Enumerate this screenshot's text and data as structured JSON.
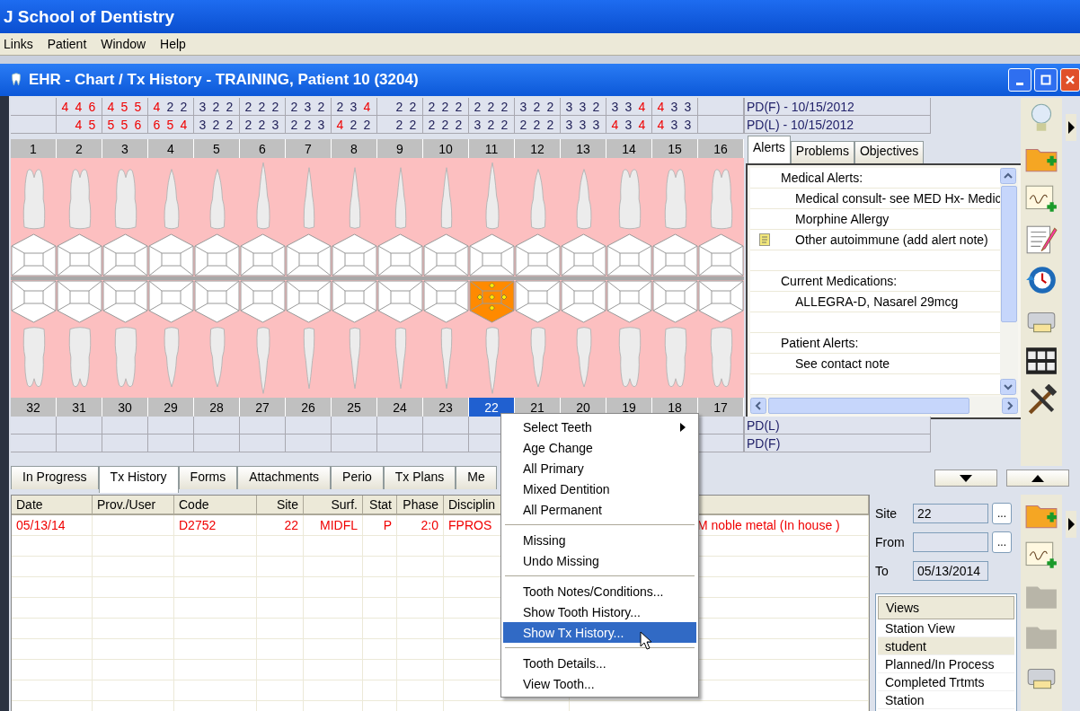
{
  "app_title": "J School of Dentistry",
  "menu": [
    "Links",
    "Patient",
    "Window",
    "Help"
  ],
  "window": {
    "title": "EHR - Chart / Tx History - TRAINING, Patient 10 (3204)"
  },
  "pd_upper": [
    {
      "label": "PD(F) - 10/15/2012",
      "cells": [
        [],
        [
          {
            "d": "4",
            "high": true
          },
          {
            "d": "4",
            "high": true
          },
          {
            "d": "6",
            "high": true
          }
        ],
        [
          {
            "d": "4",
            "high": true
          },
          {
            "d": "5",
            "high": true
          },
          {
            "d": "5",
            "high": true
          }
        ],
        [
          {
            "d": "4",
            "high": true
          },
          {
            "d": "2",
            "high": false
          },
          {
            "d": "2",
            "high": false
          }
        ],
        [
          {
            "d": "3",
            "high": false
          },
          {
            "d": "2",
            "high": false
          },
          {
            "d": "2",
            "high": false
          }
        ],
        [
          {
            "d": "2",
            "high": false
          },
          {
            "d": "2",
            "high": false
          },
          {
            "d": "2",
            "high": false
          }
        ],
        [
          {
            "d": "2",
            "high": false
          },
          {
            "d": "3",
            "high": false
          },
          {
            "d": "2",
            "high": false
          }
        ],
        [
          {
            "d": "2",
            "high": false
          },
          {
            "d": "3",
            "high": false
          },
          {
            "d": "4",
            "high": true
          }
        ],
        [
          {
            "d": "2",
            "high": false
          },
          {
            "d": "2",
            "high": false
          }
        ],
        [
          {
            "d": "2",
            "high": false
          },
          {
            "d": "2",
            "high": false
          },
          {
            "d": "2",
            "high": false
          }
        ],
        [
          {
            "d": "2",
            "high": false
          },
          {
            "d": "2",
            "high": false
          },
          {
            "d": "2",
            "high": false
          }
        ],
        [
          {
            "d": "3",
            "high": false
          },
          {
            "d": "2",
            "high": false
          },
          {
            "d": "2",
            "high": false
          }
        ],
        [
          {
            "d": "3",
            "high": false
          },
          {
            "d": "3",
            "high": false
          },
          {
            "d": "2",
            "high": false
          }
        ],
        [
          {
            "d": "3",
            "high": false
          },
          {
            "d": "3",
            "high": false
          },
          {
            "d": "4",
            "high": true
          }
        ],
        [
          {
            "d": "4",
            "high": true
          },
          {
            "d": "3",
            "high": false
          },
          {
            "d": "3",
            "high": false
          }
        ],
        []
      ]
    },
    {
      "label": "PD(L) - 10/15/2012",
      "cells": [
        [],
        [
          {
            "d": "4",
            "high": true
          },
          {
            "d": "5",
            "high": true
          }
        ],
        [
          {
            "d": "5",
            "high": true
          },
          {
            "d": "5",
            "high": true
          },
          {
            "d": "6",
            "high": true
          }
        ],
        [
          {
            "d": "6",
            "high": true
          },
          {
            "d": "5",
            "high": true
          },
          {
            "d": "4",
            "high": true
          }
        ],
        [
          {
            "d": "3",
            "high": false
          },
          {
            "d": "2",
            "high": false
          },
          {
            "d": "2",
            "high": false
          }
        ],
        [
          {
            "d": "2",
            "high": false
          },
          {
            "d": "2",
            "high": false
          },
          {
            "d": "3",
            "high": false
          }
        ],
        [
          {
            "d": "2",
            "high": false
          },
          {
            "d": "2",
            "high": false
          },
          {
            "d": "3",
            "high": false
          }
        ],
        [
          {
            "d": "4",
            "high": true
          },
          {
            "d": "2",
            "high": false
          },
          {
            "d": "2",
            "high": false
          }
        ],
        [
          {
            "d": "2",
            "high": false
          },
          {
            "d": "2",
            "high": false
          }
        ],
        [
          {
            "d": "2",
            "high": false
          },
          {
            "d": "2",
            "high": false
          },
          {
            "d": "2",
            "high": false
          }
        ],
        [
          {
            "d": "3",
            "high": false
          },
          {
            "d": "2",
            "high": false
          },
          {
            "d": "2",
            "high": false
          }
        ],
        [
          {
            "d": "2",
            "high": false
          },
          {
            "d": "2",
            "high": false
          },
          {
            "d": "2",
            "high": false
          }
        ],
        [
          {
            "d": "3",
            "high": false
          },
          {
            "d": "3",
            "high": false
          },
          {
            "d": "3",
            "high": false
          }
        ],
        [
          {
            "d": "4",
            "high": true
          },
          {
            "d": "3",
            "high": false
          },
          {
            "d": "4",
            "high": true
          }
        ],
        [
          {
            "d": "4",
            "high": true
          },
          {
            "d": "3",
            "high": false
          },
          {
            "d": "3",
            "high": false
          }
        ],
        []
      ]
    }
  ],
  "upper_teeth": [
    {
      "number": "1",
      "kind": "molar",
      "selected": false
    },
    {
      "number": "2",
      "kind": "molar",
      "selected": false
    },
    {
      "number": "3",
      "kind": "molar",
      "selected": false
    },
    {
      "number": "4",
      "kind": "premolar",
      "selected": false
    },
    {
      "number": "5",
      "kind": "premolar",
      "selected": false
    },
    {
      "number": "6",
      "kind": "canine",
      "selected": false
    },
    {
      "number": "7",
      "kind": "incisor",
      "selected": false
    },
    {
      "number": "8",
      "kind": "incisor",
      "selected": false
    },
    {
      "number": "9",
      "kind": "incisor",
      "selected": false
    },
    {
      "number": "10",
      "kind": "incisor",
      "selected": false
    },
    {
      "number": "11",
      "kind": "canine",
      "selected": false
    },
    {
      "number": "12",
      "kind": "premolar",
      "selected": false
    },
    {
      "number": "13",
      "kind": "premolar",
      "selected": false
    },
    {
      "number": "14",
      "kind": "molar",
      "selected": false
    },
    {
      "number": "15",
      "kind": "molar",
      "selected": false
    },
    {
      "number": "16",
      "kind": "molar",
      "selected": false
    }
  ],
  "lower_teeth": [
    {
      "number": "32",
      "kind": "molar",
      "selected": false
    },
    {
      "number": "31",
      "kind": "molar",
      "selected": false
    },
    {
      "number": "30",
      "kind": "molar",
      "selected": false
    },
    {
      "number": "29",
      "kind": "premolar",
      "selected": false
    },
    {
      "number": "28",
      "kind": "premolar",
      "selected": false
    },
    {
      "number": "27",
      "kind": "canine",
      "selected": false
    },
    {
      "number": "26",
      "kind": "incisor",
      "selected": false
    },
    {
      "number": "25",
      "kind": "incisor",
      "selected": false
    },
    {
      "number": "24",
      "kind": "incisor",
      "selected": false
    },
    {
      "number": "23",
      "kind": "incisor",
      "selected": false
    },
    {
      "number": "22",
      "kind": "canine",
      "selected": true
    },
    {
      "number": "21",
      "kind": "premolar",
      "selected": false
    },
    {
      "number": "20",
      "kind": "premolar",
      "selected": false
    },
    {
      "number": "19",
      "kind": "molar",
      "selected": false
    },
    {
      "number": "18",
      "kind": "molar",
      "selected": false
    },
    {
      "number": "17",
      "kind": "molar",
      "selected": false
    }
  ],
  "pd_lower": [
    {
      "label": "PD(L)"
    },
    {
      "label": "PD(F)"
    }
  ],
  "alerts_panel": {
    "tabs": [
      {
        "label": "Alerts",
        "selected": true
      },
      {
        "label": "Problems",
        "selected": false
      },
      {
        "label": "Objectives",
        "selected": false
      }
    ],
    "rows": [
      {
        "kind": "heading",
        "text": "Medical Alerts:"
      },
      {
        "kind": "item",
        "text": "Medical consult- see MED Hx- Medic",
        "note": false
      },
      {
        "kind": "item",
        "text": "Morphine Allergy",
        "note": false
      },
      {
        "kind": "item",
        "text": "Other autoimmune (add alert note)",
        "note": true
      },
      {
        "kind": "blank"
      },
      {
        "kind": "heading",
        "text": "Current Medications:"
      },
      {
        "kind": "item",
        "text": "ALLEGRA-D, Nasarel 29mcg",
        "note": false
      },
      {
        "kind": "blank"
      },
      {
        "kind": "heading",
        "text": "Patient Alerts:"
      },
      {
        "kind": "item",
        "text": "See contact note",
        "note": false
      },
      {
        "kind": "blank"
      }
    ]
  },
  "tabs": [
    {
      "label": "In Progress",
      "selected": false
    },
    {
      "label": "Tx History",
      "selected": true
    },
    {
      "label": "Forms",
      "selected": false
    },
    {
      "label": "Attachments",
      "selected": false
    },
    {
      "label": "Perio",
      "selected": false
    },
    {
      "label": "Tx Plans",
      "selected": false
    },
    {
      "label": "Me",
      "selected": false
    }
  ],
  "table": {
    "columns": [
      "Date",
      "Prov./User",
      "Code",
      "Site",
      "Surf.",
      "Stat",
      "Phase",
      "Disciplin"
    ],
    "rows": [
      {
        "date": "05/13/14",
        "code": "D2752",
        "site": "22",
        "surf": "MIDFL",
        "stat": "P",
        "phase": "2:0",
        "discipline": "FPROS",
        "description": "M noble metal (In house )"
      }
    ]
  },
  "context_menu": {
    "groups": [
      [
        {
          "label": "Select Teeth",
          "submenu": true,
          "selected": false
        },
        {
          "label": "Age Change",
          "selected": false
        },
        {
          "label": "All Primary",
          "selected": false
        },
        {
          "label": "Mixed Dentition",
          "selected": false
        },
        {
          "label": "All Permanent",
          "selected": false
        }
      ],
      [
        {
          "label": "Missing",
          "selected": false
        },
        {
          "label": "Undo Missing",
          "selected": false
        }
      ],
      [
        {
          "label": "Tooth Notes/Conditions...",
          "selected": false
        },
        {
          "label": "Show Tooth History...",
          "selected": false
        },
        {
          "label": "Show Tx History...",
          "selected": true
        }
      ],
      [
        {
          "label": "Tooth Details...",
          "selected": false
        },
        {
          "label": "View Tooth...",
          "selected": false
        }
      ]
    ]
  },
  "filters": {
    "site": {
      "label": "Site",
      "value": "22",
      "browse": "..."
    },
    "from": {
      "label": "From",
      "browse": "..."
    },
    "to": {
      "label": "To",
      "value": "05/13/2014"
    }
  },
  "views": {
    "title": "Views",
    "items": [
      {
        "label": "Station View",
        "selected": false
      },
      {
        "label": "student",
        "selected": true
      },
      {
        "label": "Planned/In Process",
        "selected": false
      },
      {
        "label": "Completed Trtmts",
        "selected": false
      },
      {
        "label": "Station",
        "selected": false
      }
    ]
  }
}
